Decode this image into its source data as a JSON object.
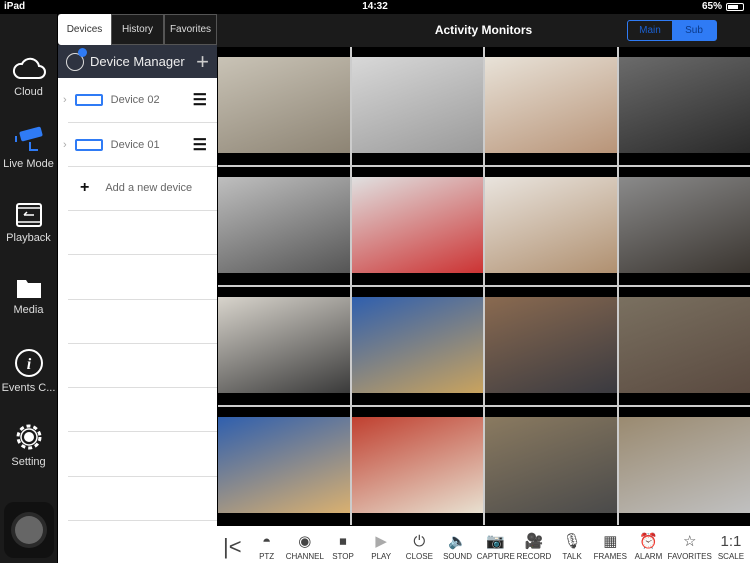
{
  "status": {
    "device": "iPad",
    "time": "14:32",
    "battery": "65%",
    "battery_level": 0.65
  },
  "sidebar": {
    "items": [
      {
        "label": "Cloud",
        "icon": "cloud-icon"
      },
      {
        "label": "Live Mode",
        "icon": "camera-icon",
        "active": true
      },
      {
        "label": "Playback",
        "icon": "playback-icon"
      },
      {
        "label": "Media",
        "icon": "folder-icon"
      },
      {
        "label": "Events C...",
        "icon": "info-icon"
      },
      {
        "label": "Setting",
        "icon": "gear-icon"
      }
    ]
  },
  "panel": {
    "tabs": [
      "Devices",
      "History",
      "Favorites"
    ],
    "active_tab": "Devices",
    "title": "Device Manager",
    "devices": [
      {
        "name": "Device 02"
      },
      {
        "name": "Device 01"
      }
    ],
    "add_label": "Add a new device"
  },
  "header": {
    "title": "Activity Monitors",
    "segments": [
      "Main",
      "Sub"
    ],
    "active_segment": "Sub"
  },
  "toolbar": {
    "items": [
      {
        "label": "PTZ",
        "icon": "ptz-icon"
      },
      {
        "label": "CHANNEL",
        "icon": "channel-icon"
      },
      {
        "label": "STOP",
        "icon": "stop-icon"
      },
      {
        "label": "PLAY",
        "icon": "play-icon"
      },
      {
        "label": "CLOSE",
        "icon": "power-icon"
      },
      {
        "label": "SOUND",
        "icon": "speaker-icon"
      },
      {
        "label": "CAPTURE",
        "icon": "camera-icon"
      },
      {
        "label": "RECORD",
        "icon": "video-icon"
      },
      {
        "label": "TALK",
        "icon": "mic-icon"
      },
      {
        "label": "FRAMES",
        "icon": "frames-icon"
      },
      {
        "label": "ALARM",
        "icon": "alarm-icon"
      },
      {
        "label": "FAVORITES",
        "icon": "star-icon"
      },
      {
        "label": "SCALE",
        "icon": "scale-icon",
        "glyph": "1:1"
      }
    ]
  },
  "colors": {
    "accent": "#2f7bf5"
  }
}
